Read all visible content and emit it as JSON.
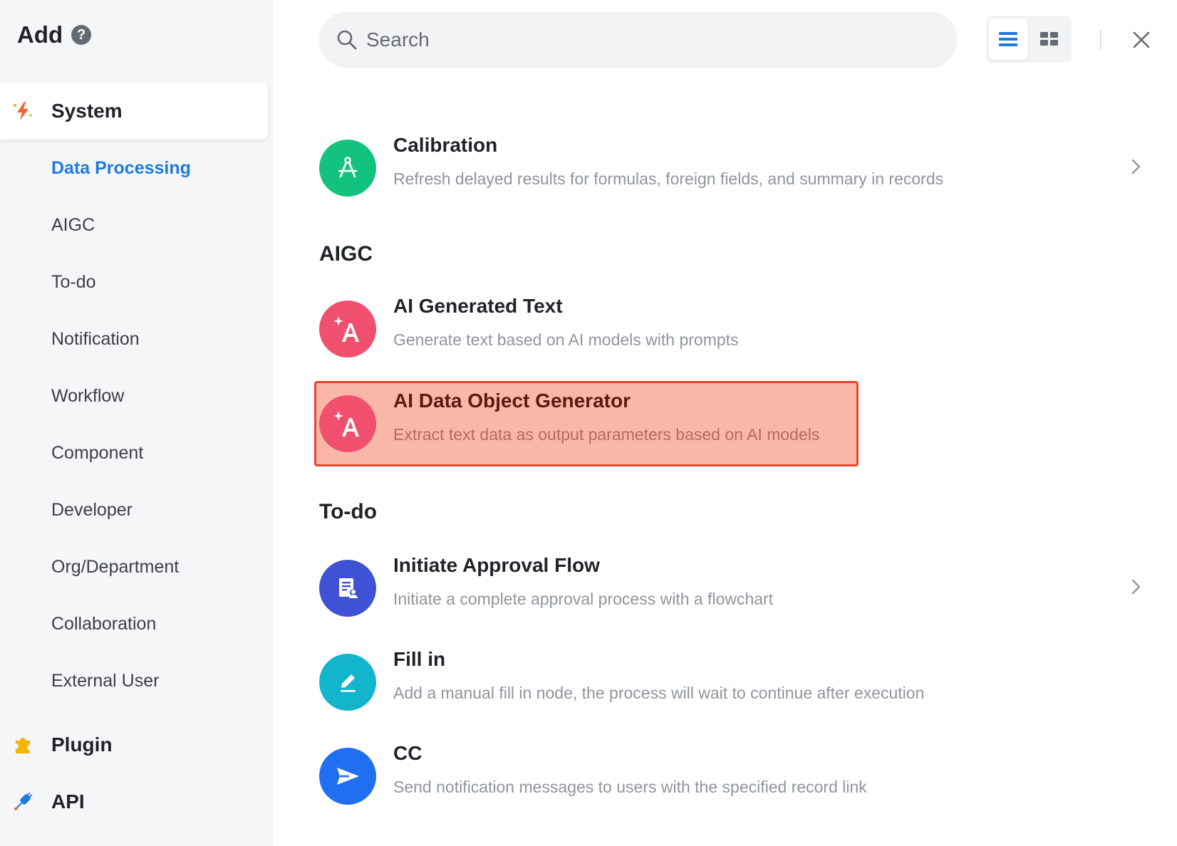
{
  "header": {
    "title": "Add",
    "help_icon": "question-icon"
  },
  "sidebar": {
    "categories": [
      {
        "label": "System",
        "icon": "lightning-icon",
        "color": "#f5622e"
      },
      {
        "label": "Plugin",
        "icon": "puzzle-icon",
        "color": "#f5b400"
      },
      {
        "label": "API",
        "icon": "plug-icon",
        "color": "#1f7ae0"
      }
    ],
    "system_items": [
      "Data Processing",
      "AIGC",
      "To-do",
      "Notification",
      "Workflow",
      "Component",
      "Developer",
      "Org/Department",
      "Collaboration",
      "External User"
    ],
    "active_item": "Data Processing"
  },
  "search": {
    "placeholder": "Search",
    "value": ""
  },
  "view_toggle": {
    "options": [
      "list-view-icon",
      "grid-view-icon"
    ],
    "active": "list-view-icon"
  },
  "main": {
    "sections": [
      {
        "title": "",
        "items": [
          {
            "title": "Calibration",
            "desc": "Refresh delayed results for formulas, foreign fields, and summary in records",
            "icon": "compass-icon",
            "color": "#13c27e",
            "has_arrow": true
          }
        ]
      },
      {
        "title": "AIGC",
        "items": [
          {
            "title": "AI Generated Text",
            "desc": "Generate text based on AI models with prompts",
            "icon": "ai-text-icon",
            "color": "#f0506e",
            "has_arrow": false
          },
          {
            "title": "AI Data Object Generator",
            "desc": "Extract text data as output parameters based on AI models",
            "icon": "ai-text-icon",
            "color": "#f0506e",
            "has_arrow": false,
            "highlighted": true
          }
        ]
      },
      {
        "title": "To-do",
        "items": [
          {
            "title": "Initiate Approval Flow",
            "desc": "Initiate a complete approval process with a flowchart",
            "icon": "approval-doc-icon",
            "color": "#3f51d4",
            "has_arrow": true
          },
          {
            "title": "Fill in",
            "desc": "Add a manual fill in node, the process will wait to continue after execution",
            "icon": "pencil-icon",
            "color": "#12b5cc",
            "has_arrow": false
          },
          {
            "title": "CC",
            "desc": "Send notification messages to users with the specified record link",
            "icon": "send-icon",
            "color": "#1f6ff0",
            "has_arrow": false
          }
        ]
      }
    ]
  }
}
